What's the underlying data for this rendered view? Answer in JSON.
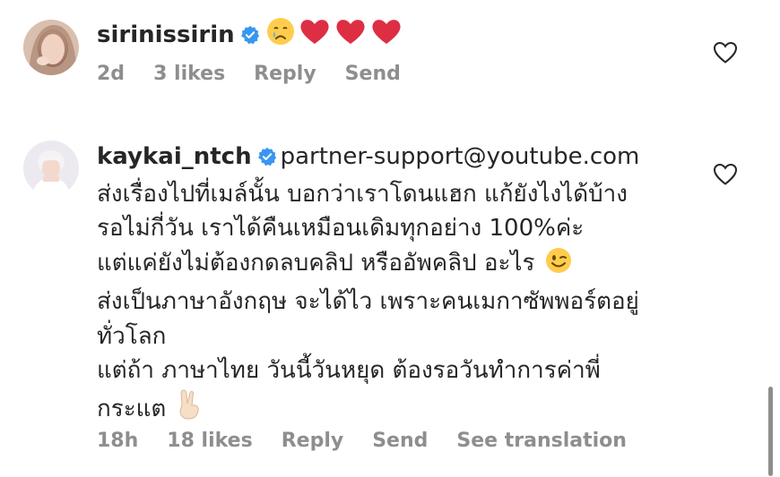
{
  "comments": [
    {
      "username": "sirinissirin",
      "text_lines": [],
      "meta": {
        "time": "2d",
        "likes": "3 likes",
        "reply": "Reply",
        "send": "Send"
      }
    },
    {
      "username": "kaykai_ntch",
      "first_line_text": "partner-support@youtube.com",
      "lines": [
        "ส่งเรื่องไปที่เมล์นั้น บอกว่าเราโดนแฮก แก้ยังไงได้บ้าง",
        "รอไม่กี่วัน เราได้คืนเหมือนเดิมทุกอย่าง 100%ค่ะ",
        "แต่แค่ยังไม่ต้องกดลบคลิป หรืออัพคลิป อะไร",
        "ส่งเป็นภาษาอังกฤษ จะได้ไว เพราะคนเมกาซัพพอร์ตอยู่",
        "ทั่วโลก",
        "แต่ถ้า ภาษาไทย วันนี้วันหยุด ต้องรอวันทำการค่าพี่",
        "กระแต"
      ],
      "meta": {
        "time": "18h",
        "likes": "18 likes",
        "reply": "Reply",
        "send": "Send",
        "translation": "See translation"
      }
    }
  ],
  "colors": {
    "text": "#262626",
    "secondary": "#8e8e8e",
    "verified": "#3897f0",
    "heart_emoji": "#e0245e"
  },
  "icons": {
    "verified": "verified-badge-icon",
    "like": "heart-outline-icon",
    "crying_emoji": "crying-face-emoji",
    "heart_emoji": "red-heart-emoji",
    "wink_emoji": "winking-face-emoji",
    "victory_emoji": "victory-hand-emoji"
  }
}
